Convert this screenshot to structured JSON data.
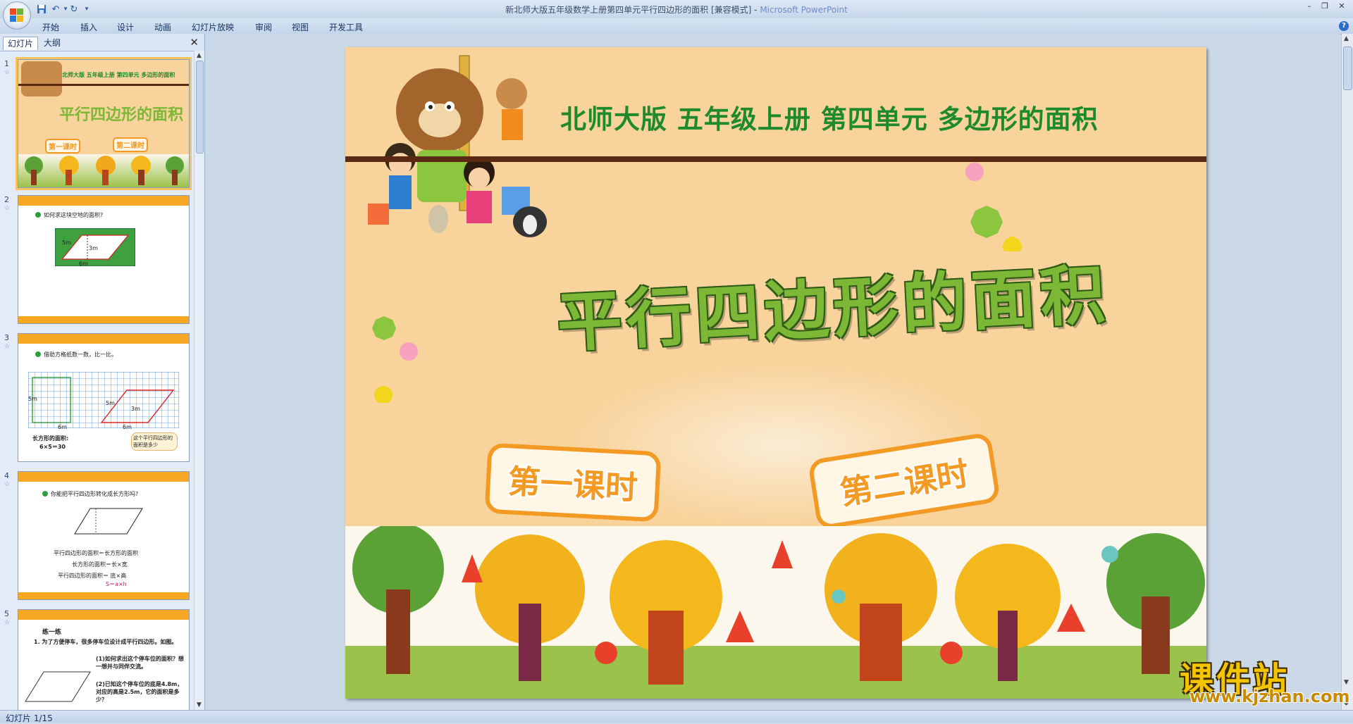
{
  "window": {
    "title": "新北师大版五年级数学上册第四单元平行四边形的面积 [兼容模式] - ",
    "app_name": "Microsoft PowerPoint"
  },
  "ribbon": {
    "tabs": [
      "开始",
      "插入",
      "设计",
      "动画",
      "幻灯片放映",
      "审阅",
      "视图",
      "开发工具"
    ]
  },
  "pane": {
    "tabs": [
      "幻灯片",
      "大纲"
    ],
    "close_glyph": "✕"
  },
  "thumbnails": [
    {
      "num": "1",
      "header": "北师大版  五年级上册  第四单元  多边形的面积",
      "title": "平行四边形的面积",
      "btn1": "第一课时",
      "btn2": "第二课时"
    },
    {
      "num": "2",
      "question": "如何求这块空地的面积?",
      "label_side": "5m",
      "label_height": "3m",
      "label_base": "6m"
    },
    {
      "num": "3",
      "question": "借助方格纸数一数，比一比。",
      "label_side": "5m",
      "label_height": "3m",
      "label_base": "6m",
      "label_rect_side": "5m",
      "label_rect_base": "6m",
      "note": "长方形的面积:",
      "calc": "6×5＝30",
      "bubble": "这个平行四边形的面积是多少"
    },
    {
      "num": "4",
      "question": "你能把平行四边形转化成长方形吗?",
      "l1": "平行四边形的面积＝长方形的面积",
      "l2": "长方形的面积＝长×宽",
      "l3": "平行四边形的面积＝ 底×高",
      "l4": "S＝a×h"
    },
    {
      "num": "5",
      "heading": "练一练",
      "q1": "1. 为了方便停车，很多停车位设计成平行四边形。如图。",
      "q2": "(1)如何求出这个停车位的面积？想一想并与同伴交流。",
      "q3": "(2)已知这个停车位的底是4.8m，对应的高是2.5m，它的面积是多少？"
    }
  ],
  "slide": {
    "header": "北师大版  五年级上册  第四单元  多边形的面积",
    "title": "平行四边形的面积",
    "button1": "第一课时",
    "button2": "第二课时"
  },
  "watermark": {
    "brand": "课件站",
    "url": "www.kjzhan.com"
  },
  "status": {
    "slide_counter": "幻灯片 1/15"
  },
  "colors": {
    "slide_bg": "#f8d39c",
    "header_green": "#1e8a2c",
    "title_green": "#7cb836",
    "button_orange": "#f39a24"
  }
}
